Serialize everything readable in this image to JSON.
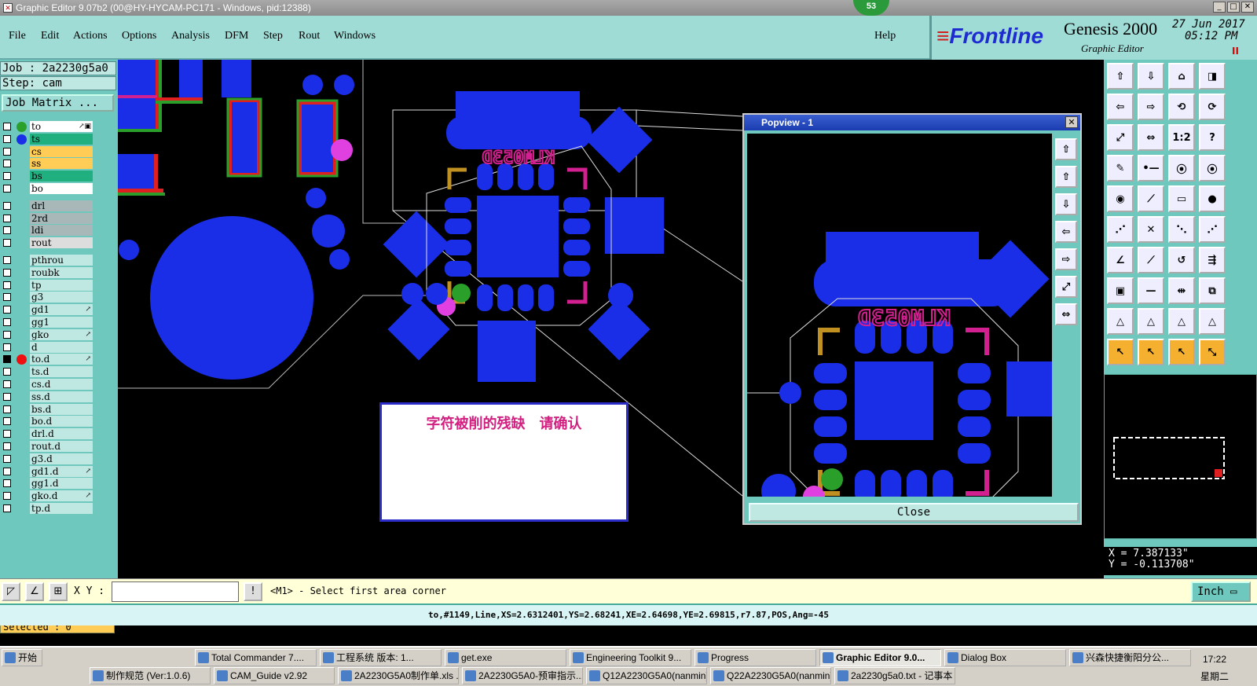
{
  "window": {
    "title": "Graphic Editor 9.07b2 (00@HY-HYCAM-PC171 - Windows, pid:12388)",
    "badge": "53"
  },
  "menu": {
    "items": [
      "File",
      "Edit",
      "Actions",
      "Options",
      "Analysis",
      "DFM",
      "Step",
      "Rout",
      "Windows"
    ],
    "help": "Help"
  },
  "brand": {
    "logo": "Frontline",
    "product": "Genesis 2000",
    "subtitle": "Graphic Editor",
    "date": "27 Jun 2017",
    "time": "05:12 PM",
    "pause": "II"
  },
  "info": {
    "job": "Job : 2a2230g5a0",
    "step": "Step: cam",
    "job_matrix": "Job Matrix ..."
  },
  "layers": [
    {
      "name": "to",
      "color": "#2aa02a",
      "bg": "#ffffff",
      "tag": "↗▣",
      "checked": false
    },
    {
      "name": "ts",
      "color": "#1a2ee8",
      "bg": "#20b080",
      "tag": "",
      "checked": false
    },
    {
      "name": "cs",
      "color": "",
      "bg": "#ffcc55",
      "tag": "",
      "checked": false
    },
    {
      "name": "ss",
      "color": "",
      "bg": "#ffcc55",
      "tag": "",
      "checked": false
    },
    {
      "name": "bs",
      "color": "",
      "bg": "#20b080",
      "tag": "",
      "checked": false
    },
    {
      "name": "bo",
      "color": "",
      "bg": "#ffffff",
      "tag": "",
      "checked": false
    },
    {
      "name": "drl",
      "color": "",
      "bg": "#a8b8b8",
      "tag": "",
      "checked": false
    },
    {
      "name": "2rd",
      "color": "",
      "bg": "#a8b8b8",
      "tag": "",
      "checked": false
    },
    {
      "name": "ldi",
      "color": "",
      "bg": "#a8b8b8",
      "tag": "",
      "checked": false
    },
    {
      "name": "rout",
      "color": "",
      "bg": "#dddddd",
      "tag": "",
      "checked": false
    },
    {
      "name": "pthrou",
      "color": "",
      "bg": "#bfe8e3",
      "tag": "",
      "checked": false
    },
    {
      "name": "roubk",
      "color": "",
      "bg": "#bfe8e3",
      "tag": "",
      "checked": false
    },
    {
      "name": "tp",
      "color": "",
      "bg": "#bfe8e3",
      "tag": "",
      "checked": false
    },
    {
      "name": "g3",
      "color": "",
      "bg": "#bfe8e3",
      "tag": "",
      "checked": false
    },
    {
      "name": "gd1",
      "color": "",
      "bg": "#bfe8e3",
      "tag": "↗",
      "checked": false
    },
    {
      "name": "gg1",
      "color": "",
      "bg": "#bfe8e3",
      "tag": "",
      "checked": false
    },
    {
      "name": "gko",
      "color": "",
      "bg": "#bfe8e3",
      "tag": "↗",
      "checked": false
    },
    {
      "name": "d",
      "color": "",
      "bg": "#bfe8e3",
      "tag": "",
      "checked": false
    },
    {
      "name": "to.d",
      "color": "#ee1010",
      "bg": "#bfe8e3",
      "tag": "↗",
      "checked": true
    },
    {
      "name": "ts.d",
      "color": "",
      "bg": "#bfe8e3",
      "tag": "",
      "checked": false
    },
    {
      "name": "cs.d",
      "color": "",
      "bg": "#bfe8e3",
      "tag": "",
      "checked": false
    },
    {
      "name": "ss.d",
      "color": "",
      "bg": "#bfe8e3",
      "tag": "",
      "checked": false
    },
    {
      "name": "bs.d",
      "color": "",
      "bg": "#bfe8e3",
      "tag": "",
      "checked": false
    },
    {
      "name": "bo.d",
      "color": "",
      "bg": "#bfe8e3",
      "tag": "",
      "checked": false
    },
    {
      "name": "drl.d",
      "color": "",
      "bg": "#bfe8e3",
      "tag": "",
      "checked": false
    },
    {
      "name": "rout.d",
      "color": "",
      "bg": "#bfe8e3",
      "tag": "",
      "checked": false
    },
    {
      "name": "g3.d",
      "color": "",
      "bg": "#bfe8e3",
      "tag": "",
      "checked": false
    },
    {
      "name": "gd1.d",
      "color": "",
      "bg": "#bfe8e3",
      "tag": "↗",
      "checked": false
    },
    {
      "name": "gg1.d",
      "color": "",
      "bg": "#bfe8e3",
      "tag": "",
      "checked": false
    },
    {
      "name": "gko.d",
      "color": "",
      "bg": "#bfe8e3",
      "tag": "↗",
      "checked": false
    },
    {
      "name": "tp.d",
      "color": "",
      "bg": "#bfe8e3",
      "tag": "",
      "checked": false
    }
  ],
  "selected": "Selected : 0",
  "popview": {
    "title": "Popview - 1",
    "close": "Close",
    "silk_text": "KLM053D"
  },
  "canvas": {
    "silk_text": "KLM053D",
    "note": "字符被削的残缺　请确认"
  },
  "coords": {
    "x": "X = 7.387133\"",
    "y": "Y = -0.113708\""
  },
  "cmd": {
    "xy_label": "X Y :",
    "xy_value": "",
    "prompt": "<M1> - Select first area corner",
    "units": "Inch"
  },
  "status": "to,#1149,Line,XS=2.6312401,YS=2.68241,XE=2.64698,YE=2.69815,r7.87,POS,Ang=-45",
  "taskbar": {
    "start": "开始",
    "row1": [
      "Total Commander 7....",
      "工程系统  版本: 1...",
      "get.exe",
      "Engineering Toolkit 9...",
      "Progress",
      "Graphic Editor 9.0...",
      "Dialog Box",
      "兴森快捷衡阳分公..."
    ],
    "row2": [
      "制作规范 (Ver:1.0.6)",
      "CAM_Guide v2.92",
      "2A2230G5A0制作单.xls ...",
      "2A2230G5A0-预审指示....",
      "Q12A2230G5A0(nanmin)...",
      "Q22A2230G5A0(nanmin)...",
      "2a2230g5a0.txt - 记事本"
    ],
    "active": "Graphic Editor 9.0...",
    "time": "17:22",
    "day": "星期二"
  },
  "colors": {
    "pad": "#1a2ee8",
    "silk": "#d22090",
    "panel": "#6fc8bd",
    "menu": "#9fdcd6"
  }
}
